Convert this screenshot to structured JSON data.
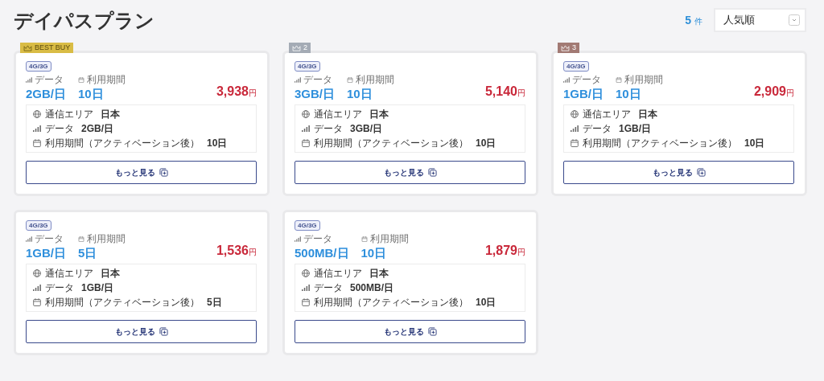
{
  "title": "デイパスプラン",
  "result_count": {
    "number": "5",
    "unit": "件"
  },
  "sort": {
    "value": "人気順"
  },
  "plans": [
    {
      "badge": {
        "kind": "best",
        "label": "BEST BUY",
        "color": "#d9bc45"
      },
      "network": "4G/3G",
      "data_label": "データ",
      "data_value": "2GB/日",
      "period_label": "利用期間",
      "period_value": "10日",
      "price": "3,938",
      "currency": "円",
      "details": [
        {
          "kind": "area",
          "label": "通信エリア",
          "value": "日本"
        },
        {
          "kind": "data",
          "label": "データ",
          "value": "2GB/日"
        },
        {
          "kind": "period",
          "label": "利用期間（アクティベーション後）",
          "value": "10日"
        }
      ],
      "button": "もっと見る"
    },
    {
      "badge": {
        "kind": "rank",
        "label": "2",
        "color": "#a4abb5"
      },
      "network": "4G/3G",
      "data_label": "データ",
      "data_value": "3GB/日",
      "period_label": "利用期間",
      "period_value": "10日",
      "price": "5,140",
      "currency": "円",
      "details": [
        {
          "kind": "area",
          "label": "通信エリア",
          "value": "日本"
        },
        {
          "kind": "data",
          "label": "データ",
          "value": "3GB/日"
        },
        {
          "kind": "period",
          "label": "利用期間（アクティベーション後）",
          "value": "10日"
        }
      ],
      "button": "もっと見る"
    },
    {
      "badge": {
        "kind": "rank",
        "label": "3",
        "color": "#a27a74"
      },
      "network": "4G/3G",
      "data_label": "データ",
      "data_value": "1GB/日",
      "period_label": "利用期間",
      "period_value": "10日",
      "price": "2,909",
      "currency": "円",
      "details": [
        {
          "kind": "area",
          "label": "通信エリア",
          "value": "日本"
        },
        {
          "kind": "data",
          "label": "データ",
          "value": "1GB/日"
        },
        {
          "kind": "period",
          "label": "利用期間（アクティベーション後）",
          "value": "10日"
        }
      ],
      "button": "もっと見る"
    },
    {
      "network": "4G/3G",
      "data_label": "データ",
      "data_value": "1GB/日",
      "period_label": "利用期間",
      "period_value": "5日",
      "price": "1,536",
      "currency": "円",
      "details": [
        {
          "kind": "area",
          "label": "通信エリア",
          "value": "日本"
        },
        {
          "kind": "data",
          "label": "データ",
          "value": "1GB/日"
        },
        {
          "kind": "period",
          "label": "利用期間（アクティベーション後）",
          "value": "5日"
        }
      ],
      "button": "もっと見る"
    },
    {
      "network": "4G/3G",
      "data_label": "データ",
      "data_value": "500MB/日",
      "period_label": "利用期間",
      "period_value": "10日",
      "price": "1,879",
      "currency": "円",
      "details": [
        {
          "kind": "area",
          "label": "通信エリア",
          "value": "日本"
        },
        {
          "kind": "data",
          "label": "データ",
          "value": "500MB/日"
        },
        {
          "kind": "period",
          "label": "利用期間（アクティベーション後）",
          "value": "10日"
        }
      ],
      "button": "もっと見る"
    }
  ]
}
